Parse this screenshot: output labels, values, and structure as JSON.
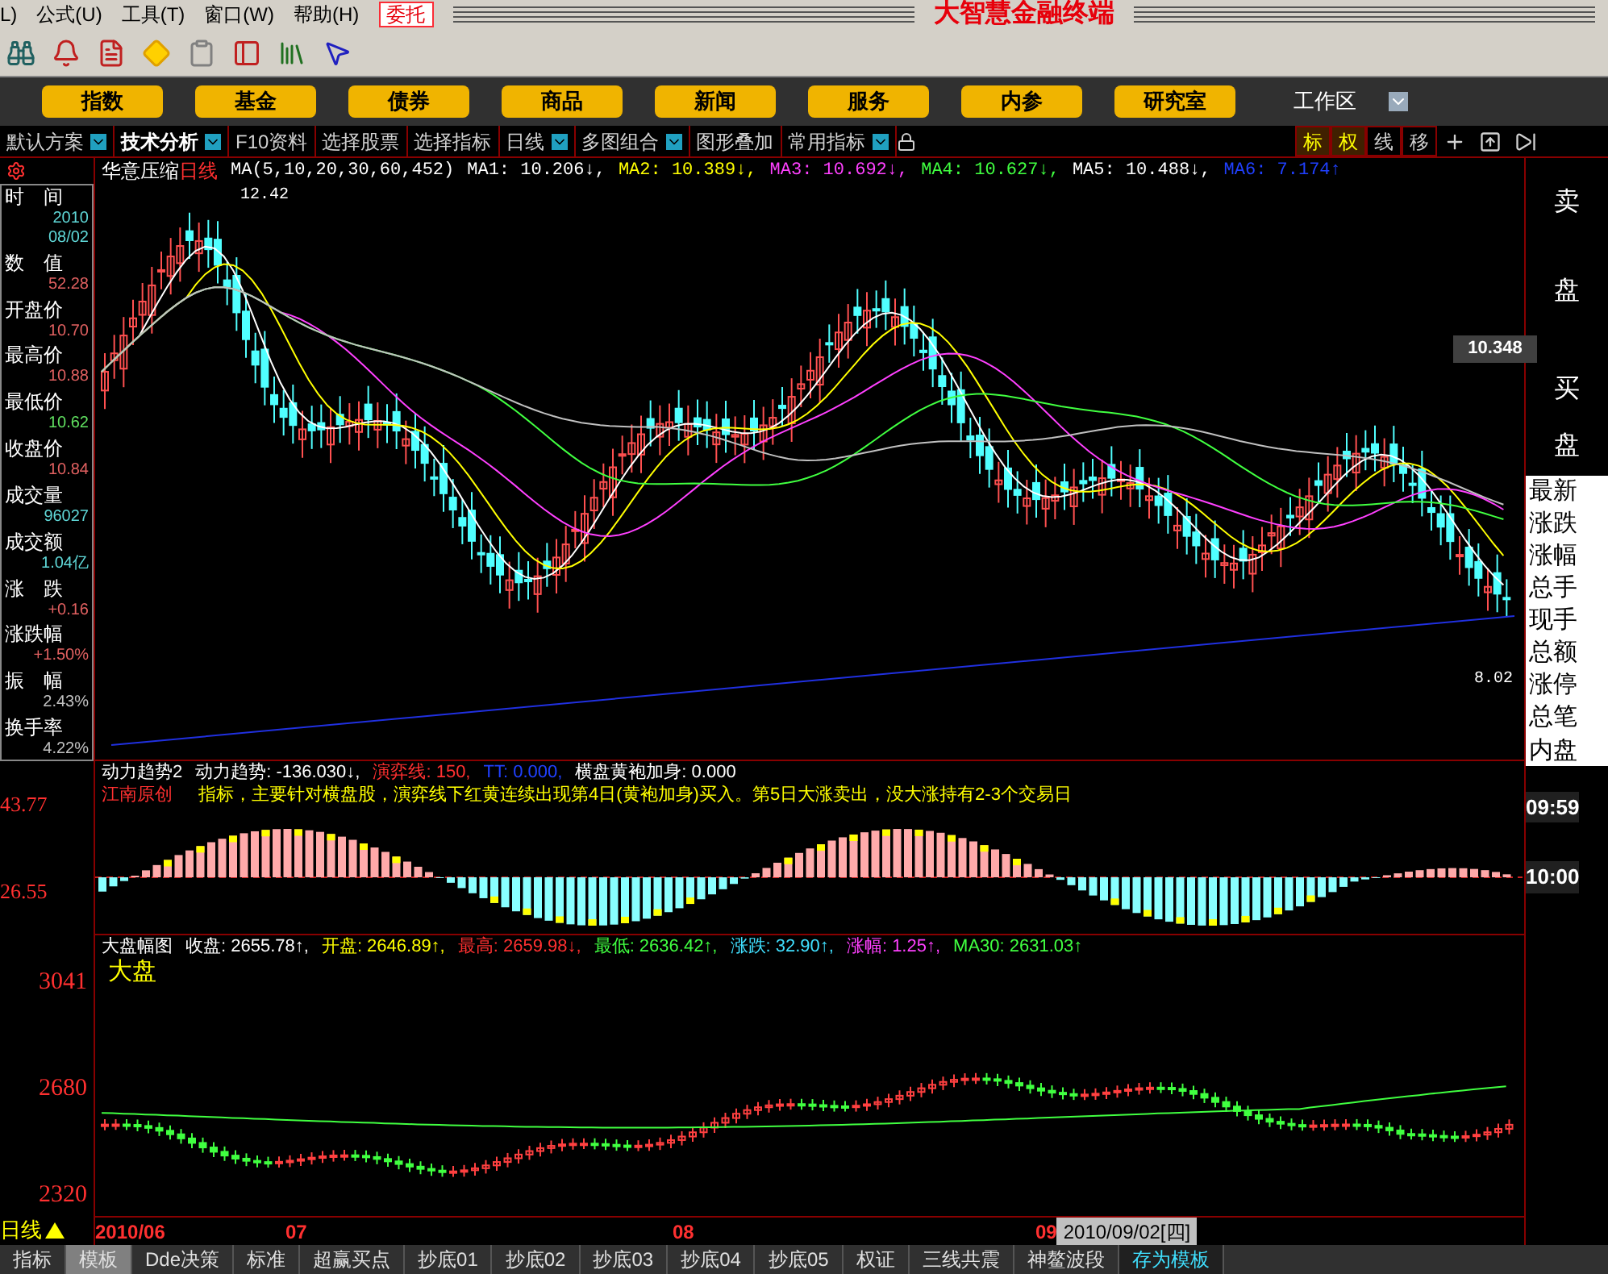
{
  "menu": {
    "items": [
      "L)",
      "公式(U)",
      "工具(T)",
      "窗口(W)",
      "帮助(H)"
    ],
    "trade_button": "委托",
    "app_title": "大智慧金融终端"
  },
  "nav_buttons": [
    "指数",
    "基金",
    "债券",
    "商品",
    "新闻",
    "服务",
    "内参",
    "研究室"
  ],
  "workspace": "工作区",
  "tabs": [
    {
      "label": "默认方案",
      "dropdown": true,
      "selected": false
    },
    {
      "label": "技术分析",
      "dropdown": true,
      "selected": true
    },
    {
      "label": "F10资料",
      "dropdown": false,
      "selected": false
    },
    {
      "label": "选择股票",
      "dropdown": false,
      "selected": false
    },
    {
      "label": "选择指标",
      "dropdown": false,
      "selected": false
    },
    {
      "label": "日线",
      "dropdown": true,
      "selected": false
    },
    {
      "label": "多图组合",
      "dropdown": true,
      "selected": false
    },
    {
      "label": "图形叠加",
      "dropdown": false,
      "selected": false
    },
    {
      "label": "常用指标",
      "dropdown": true,
      "selected": false
    }
  ],
  "chart_tools": [
    {
      "label": "标",
      "highlighted": true
    },
    {
      "label": "权",
      "highlighted": true
    },
    {
      "label": "线",
      "highlighted": false
    },
    {
      "label": "移",
      "highlighted": false
    }
  ],
  "info_panel": [
    {
      "label": "时　间",
      "values": [
        "2010",
        "08/02"
      ],
      "color": "#5fd7d7"
    },
    {
      "label": "数　值",
      "values": [
        "52.28"
      ],
      "color": "#e06060"
    },
    {
      "label": "开盘价",
      "values": [
        "10.70"
      ],
      "color": "#e06060"
    },
    {
      "label": "最高价",
      "values": [
        "10.88"
      ],
      "color": "#e06060"
    },
    {
      "label": "最低价",
      "values": [
        "10.62"
      ],
      "color": "#60e060"
    },
    {
      "label": "收盘价",
      "values": [
        "10.84"
      ],
      "color": "#e06060"
    },
    {
      "label": "成交量",
      "values": [
        "96027"
      ],
      "color": "#5fd7d7"
    },
    {
      "label": "成交额",
      "values": [
        "1.04亿"
      ],
      "color": "#5fd7d7"
    },
    {
      "label": "涨　跌",
      "values": [
        "+0.16"
      ],
      "color": "#e06060"
    },
    {
      "label": "涨跌幅",
      "values": [
        "+1.50%"
      ],
      "color": "#e06060"
    },
    {
      "label": "振　幅",
      "values": [
        "2.43%"
      ],
      "color": "#c0c0c0"
    },
    {
      "label": "换手率",
      "values": [
        "4.22%"
      ],
      "color": "#c0c0c0"
    }
  ],
  "main_chart": {
    "stock": "华意压缩",
    "period": "日线",
    "legend": [
      {
        "text": "MA(5,10,20,30,60,452)",
        "color": "#ffffff"
      },
      {
        "text": "MA1: 10.206↓,",
        "color": "#ffffff"
      },
      {
        "text": "MA2: 10.389↓,",
        "color": "#ffff00"
      },
      {
        "text": "MA3: 10.692↓,",
        "color": "#ff40ff"
      },
      {
        "text": "MA4: 10.627↓,",
        "color": "#40ff40"
      },
      {
        "text": "MA5: 10.488↓,",
        "color": "#ffffff"
      },
      {
        "text": "MA6: 7.174↑",
        "color": "#2040ff"
      }
    ],
    "high_label": "12.42",
    "low_label": "8.02",
    "price_label": "10.348"
  },
  "indicator": {
    "name": "动力趋势2",
    "legend": [
      {
        "text": "动力趋势: -136.030↓,",
        "color": "#ffffff"
      },
      {
        "text": "演弈线: 150,",
        "color": "#ff3030"
      },
      {
        "text": "TT: 0.000,",
        "color": "#2040ff"
      },
      {
        "text": "横盘黄袍加身: 0.000",
        "color": "#ffffff"
      }
    ],
    "author": "江南原创",
    "note": "指标，主要针对横盘股，演弈线下红黄连续出现第4日(黄袍加身)买入。第5日大涨卖出，没大涨持有2-3个交易日",
    "axis": [
      "43.77",
      "26.55"
    ],
    "time_labels": [
      "09:59",
      "10:00"
    ]
  },
  "market_chart": {
    "name": "大盘幅图",
    "label": "大盘",
    "legend": [
      {
        "text": "收盘: 2655.78↑,",
        "color": "#ffffff"
      },
      {
        "text": "开盘: 2646.89↑,",
        "color": "#ffff00"
      },
      {
        "text": "最高: 2659.98↓,",
        "color": "#ff3030"
      },
      {
        "text": "最低: 2636.42↑,",
        "color": "#40ff40"
      },
      {
        "text": "涨跌: 32.90↑,",
        "color": "#40e0ff"
      },
      {
        "text": "涨幅: 1.25↑,",
        "color": "#ff40ff"
      },
      {
        "text": "MA30: 2631.03↑",
        "color": "#40ff40"
      }
    ],
    "axis": [
      "3041",
      "2680",
      "2320"
    ]
  },
  "right_panel": {
    "sell": [
      "卖",
      "盘"
    ],
    "buy": [
      "买",
      "盘"
    ],
    "fields": [
      "最新",
      "涨跌",
      "涨幅",
      "总手",
      "现手",
      "总额",
      "涨停",
      "总笔",
      "内盘"
    ]
  },
  "date_axis": {
    "period": "日线",
    "dates": [
      "2010/06",
      "07",
      "08",
      "09"
    ],
    "cursor_date": "2010/09/02[四]"
  },
  "bottom_tabs": [
    {
      "label": "指标",
      "selected": false,
      "kind": "plain"
    },
    {
      "label": "模板",
      "selected": true,
      "kind": "plain"
    },
    {
      "label": "Dde决策",
      "selected": false,
      "kind": "plain"
    },
    {
      "label": "标准",
      "selected": false,
      "kind": "plain"
    },
    {
      "label": "超赢买点",
      "selected": false,
      "kind": "plain"
    },
    {
      "label": "抄底01",
      "selected": false,
      "kind": "plain"
    },
    {
      "label": "抄底02",
      "selected": false,
      "kind": "plain"
    },
    {
      "label": "抄底03",
      "selected": false,
      "kind": "plain"
    },
    {
      "label": "抄底04",
      "selected": false,
      "kind": "plain"
    },
    {
      "label": "抄底05",
      "selected": false,
      "kind": "plain"
    },
    {
      "label": "权证",
      "selected": false,
      "kind": "plain"
    },
    {
      "label": "三线共震",
      "selected": false,
      "kind": "plain"
    },
    {
      "label": "神鳌波段",
      "selected": false,
      "kind": "plain"
    },
    {
      "label": "存为模板",
      "selected": false,
      "kind": "action"
    }
  ]
}
